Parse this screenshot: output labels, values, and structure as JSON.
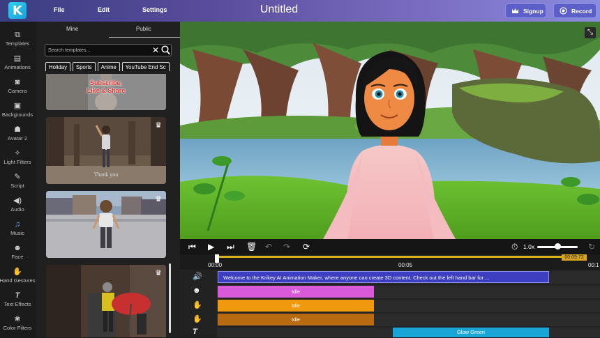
{
  "app": {
    "title": "Untitled",
    "logo_letter": "K"
  },
  "menu": {
    "file": "File",
    "edit": "Edit",
    "settings": "Settings"
  },
  "top_buttons": {
    "signup": "Signup",
    "record": "Record"
  },
  "rail": [
    {
      "label": "Templates",
      "icon": "templates-icon",
      "glyph": "⧉"
    },
    {
      "label": "Animations",
      "icon": "animations-icon",
      "glyph": "▤"
    },
    {
      "label": "Camera",
      "icon": "camera-icon",
      "glyph": "◙"
    },
    {
      "label": "Backgrounds",
      "icon": "backgrounds-icon",
      "glyph": "▣"
    },
    {
      "label": "Avatar 2",
      "icon": "avatar-icon",
      "glyph": "☗"
    },
    {
      "label": "Light Filters",
      "icon": "light-bulb-icon",
      "glyph": "✧"
    },
    {
      "label": "Script",
      "icon": "script-icon",
      "glyph": "✎"
    },
    {
      "label": "Audio",
      "icon": "speaker-icon",
      "glyph": "◀)"
    },
    {
      "label": "Music",
      "icon": "music-icon",
      "glyph": "♫"
    },
    {
      "label": "Face",
      "icon": "face-icon",
      "glyph": "☻"
    },
    {
      "label": "Hand Gestures",
      "icon": "hand-icon",
      "glyph": "✋"
    },
    {
      "label": "Text Effects",
      "icon": "text-icon",
      "glyph": "T"
    },
    {
      "label": "Color Filters",
      "icon": "color-filter-icon",
      "glyph": "❀"
    }
  ],
  "panel": {
    "tabs": [
      "Mine",
      "Public"
    ],
    "search_placeholder": "Search templates...",
    "chips": [
      "Holiday",
      "Sports",
      "Anime",
      "YouTube End Sc"
    ],
    "thumbs": [
      {
        "caption": "Subscribe,\nLike & Share",
        "crown": false
      },
      {
        "caption": "Thank you",
        "crown": true
      },
      {
        "caption": "",
        "crown": true
      },
      {
        "caption": "",
        "crown": true
      }
    ]
  },
  "controls": {
    "speed": "1.0x",
    "speed_value": 0.5
  },
  "timeline": {
    "ticks": [
      "00:00",
      "00:05",
      "00:1"
    ],
    "end_time": "00:09:72",
    "tracks": [
      {
        "icon": "speaker-icon",
        "glyph": "🔊",
        "clip_label": "Welcome to the Krikey AI Animation Maker, where anyone can create 3D content. Check out the left hand bar for ...",
        "color": "#3d3ec0"
      },
      {
        "icon": "face-icon",
        "glyph": "☻",
        "clip_label": "Idle",
        "color": "#d85ad8"
      },
      {
        "icon": "hand-icon",
        "glyph": "✋",
        "clip_label": "Idle",
        "color": "#f0980e"
      },
      {
        "icon": "hand-icon",
        "glyph": "✋",
        "clip_label": "Idle",
        "color": "#b86a10"
      },
      {
        "icon": "text-icon",
        "glyph": "T",
        "clip_label": "Glow Green",
        "color": "#19a6d6"
      }
    ]
  }
}
